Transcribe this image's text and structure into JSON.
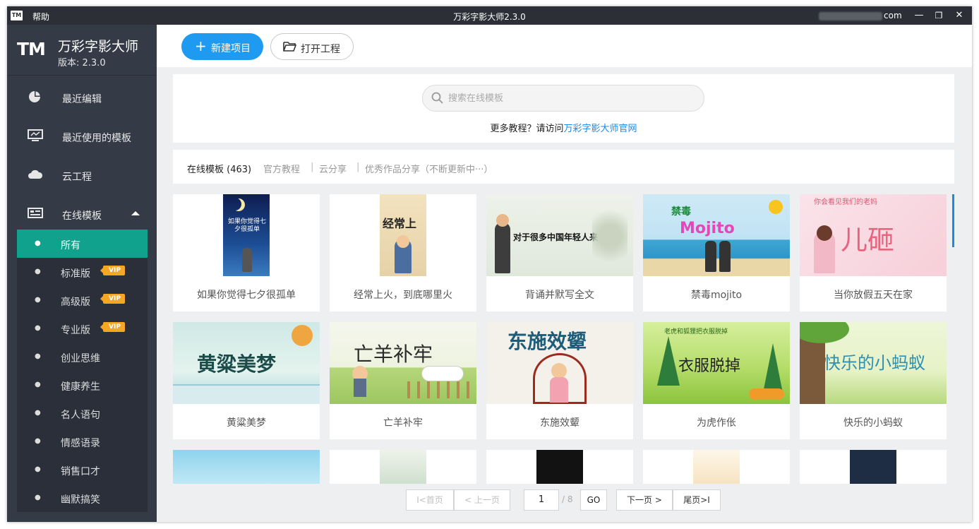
{
  "titlebar": {
    "logo": "TM",
    "help": "帮助",
    "title": "万彩字影大师2.3.0",
    "user_suffix": "com",
    "minimize": "—",
    "restore": "❐",
    "close": "✕"
  },
  "brand": {
    "logo": "TM",
    "name": "万彩字影大师",
    "version": "版本: 2.3.0"
  },
  "sidebar": {
    "nav": [
      {
        "label": "最近编辑",
        "icon": "pie-chart-icon"
      },
      {
        "label": "最近使用的模板",
        "icon": "monitor-icon"
      },
      {
        "label": "云工程",
        "icon": "cloud-icon"
      },
      {
        "label": "在线模板",
        "icon": "template-list-icon",
        "expanded": true
      }
    ],
    "sub_items": [
      {
        "label": "所有",
        "active": true,
        "vip": false
      },
      {
        "label": "标准版",
        "vip": true
      },
      {
        "label": "高级版",
        "vip": true
      },
      {
        "label": "专业版",
        "vip": true
      },
      {
        "label": "创业思维",
        "vip": false
      },
      {
        "label": "健康养生",
        "vip": false
      },
      {
        "label": "名人语句",
        "vip": false
      },
      {
        "label": "情感语录",
        "vip": false
      },
      {
        "label": "销售口才",
        "vip": false
      },
      {
        "label": "幽默搞笑",
        "vip": false
      }
    ],
    "vip_label": "VIP",
    "bullet": "●"
  },
  "toolbar": {
    "new_project": "新建项目",
    "open_project": "打开工程"
  },
  "search": {
    "placeholder": "搜索在线模板",
    "tutorial_prefix": "更多教程？请访问",
    "tutorial_link": "万彩字影大师官网"
  },
  "tabs": [
    {
      "label": "在线模板 (463)",
      "active": true
    },
    {
      "label": "官方教程"
    },
    {
      "label": "云分享"
    },
    {
      "label": "优秀作品分享（不断更新中···）"
    }
  ],
  "tab_separator": "|",
  "templates": [
    {
      "caption": "如果你觉得七夕很孤单",
      "thumb_text": "如果你觉得七夕很孤单"
    },
    {
      "caption": "经常上火，到底哪里火",
      "thumb_text": "经常上"
    },
    {
      "caption": "背诵并默写全文",
      "thumb_text": "对于很多中国年轻人来讲"
    },
    {
      "caption": "禁毒mojito",
      "thumb_text": "Mojito"
    },
    {
      "caption": "当你放假五天在家",
      "thumb_text": "儿砸"
    },
    {
      "caption": "黄粱美梦",
      "thumb_text": "黄粱美梦"
    },
    {
      "caption": "亡羊补牢",
      "thumb_text": "亡羊补牢"
    },
    {
      "caption": "东施效颦",
      "thumb_text": "东施效颦"
    },
    {
      "caption": "为虎作伥",
      "thumb_text": "衣服脱掉"
    },
    {
      "caption": "快乐的小蚂蚁",
      "thumb_text": "快乐的小蚂蚁"
    }
  ],
  "pager": {
    "first": "首页",
    "prev": "上一页",
    "current": "1",
    "total": "/ 8",
    "go": "GO",
    "next": "下一页",
    "last": "尾页"
  },
  "colors": {
    "accent": "#1e9bf0",
    "sidebar": "#343a46",
    "active_item": "#10a28c",
    "vip": "#f5a623"
  }
}
